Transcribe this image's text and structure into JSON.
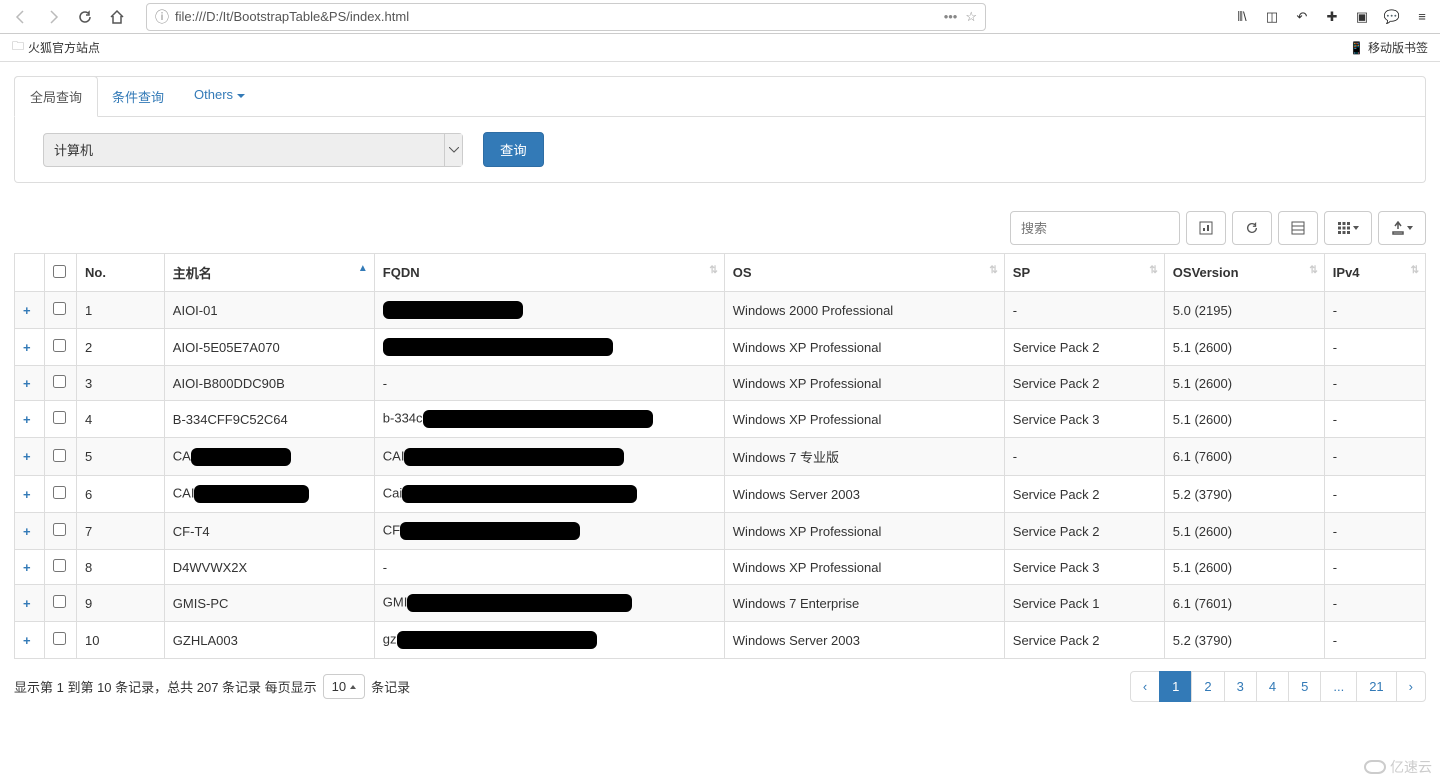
{
  "browser": {
    "url": "file:///D:/It/BootstrapTable&PS/index.html",
    "bookmarks": {
      "folder": "火狐官方站点",
      "mobile": "移动版书签"
    }
  },
  "tabs": {
    "global": "全局查询",
    "conditional": "条件查询",
    "others": "Others"
  },
  "filter": {
    "select_value": "计算机",
    "query_btn": "查询"
  },
  "toolbar": {
    "search_placeholder": "搜索"
  },
  "columns": {
    "no": "No.",
    "host": "主机名",
    "fqdn": "FQDN",
    "os": "OS",
    "sp": "SP",
    "osver": "OSVersion",
    "ipv4": "IPv4"
  },
  "rows": [
    {
      "no": "1",
      "host": "AIOI-01",
      "fqdn": "[redacted]",
      "os": "Windows 2000 Professional",
      "sp": "-",
      "osver": "5.0 (2195)",
      "ipv4": "-"
    },
    {
      "no": "2",
      "host": "AIOI-5E05E7A070",
      "fqdn": "[redacted]",
      "os": "Windows XP Professional",
      "sp": "Service Pack 2",
      "osver": "5.1 (2600)",
      "ipv4": "-"
    },
    {
      "no": "3",
      "host": "AIOI-B800DDC90B",
      "fqdn": "-",
      "os": "Windows XP Professional",
      "sp": "Service Pack 2",
      "osver": "5.1 (2600)",
      "ipv4": "-"
    },
    {
      "no": "4",
      "host": "B-334CFF9C52C64",
      "fqdn": "b-334c[redacted]",
      "os": "Windows XP Professional",
      "sp": "Service Pack 3",
      "osver": "5.1 (2600)",
      "ipv4": "-"
    },
    {
      "no": "5",
      "host": "CA[redacted]",
      "fqdn": "CAI[redacted]",
      "os": "Windows 7 专业版",
      "sp": "-",
      "osver": "6.1 (7600)",
      "ipv4": "-"
    },
    {
      "no": "6",
      "host": "CAI[redacted]",
      "fqdn": "Cai[redacted]",
      "os": "Windows Server 2003",
      "sp": "Service Pack 2",
      "osver": "5.2 (3790)",
      "ipv4": "-"
    },
    {
      "no": "7",
      "host": "CF-T4",
      "fqdn": "CF[redacted]",
      "os": "Windows XP Professional",
      "sp": "Service Pack 2",
      "osver": "5.1 (2600)",
      "ipv4": "-"
    },
    {
      "no": "8",
      "host": "D4WVWX2X",
      "fqdn": "-",
      "os": "Windows XP Professional",
      "sp": "Service Pack 3",
      "osver": "5.1 (2600)",
      "ipv4": "-"
    },
    {
      "no": "9",
      "host": "GMIS-PC",
      "fqdn": "GMI[redacted]",
      "os": "Windows 7 Enterprise",
      "sp": "Service Pack 1",
      "osver": "6.1 (7601)",
      "ipv4": "-"
    },
    {
      "no": "10",
      "host": "GZHLA003",
      "fqdn": "gz[redacted]",
      "os": "Windows Server 2003",
      "sp": "Service Pack 2",
      "osver": "5.2 (3790)",
      "ipv4": "-"
    }
  ],
  "footer": {
    "summary_prefix": "显示第 1 到第 10 条记录，总共 207 条记录 每页显示",
    "page_size": "10",
    "summary_suffix": "条记录",
    "pages": [
      "‹",
      "1",
      "2",
      "3",
      "4",
      "5",
      "...",
      "21",
      "›"
    ],
    "active_page": "1"
  },
  "watermark": "亿速云"
}
